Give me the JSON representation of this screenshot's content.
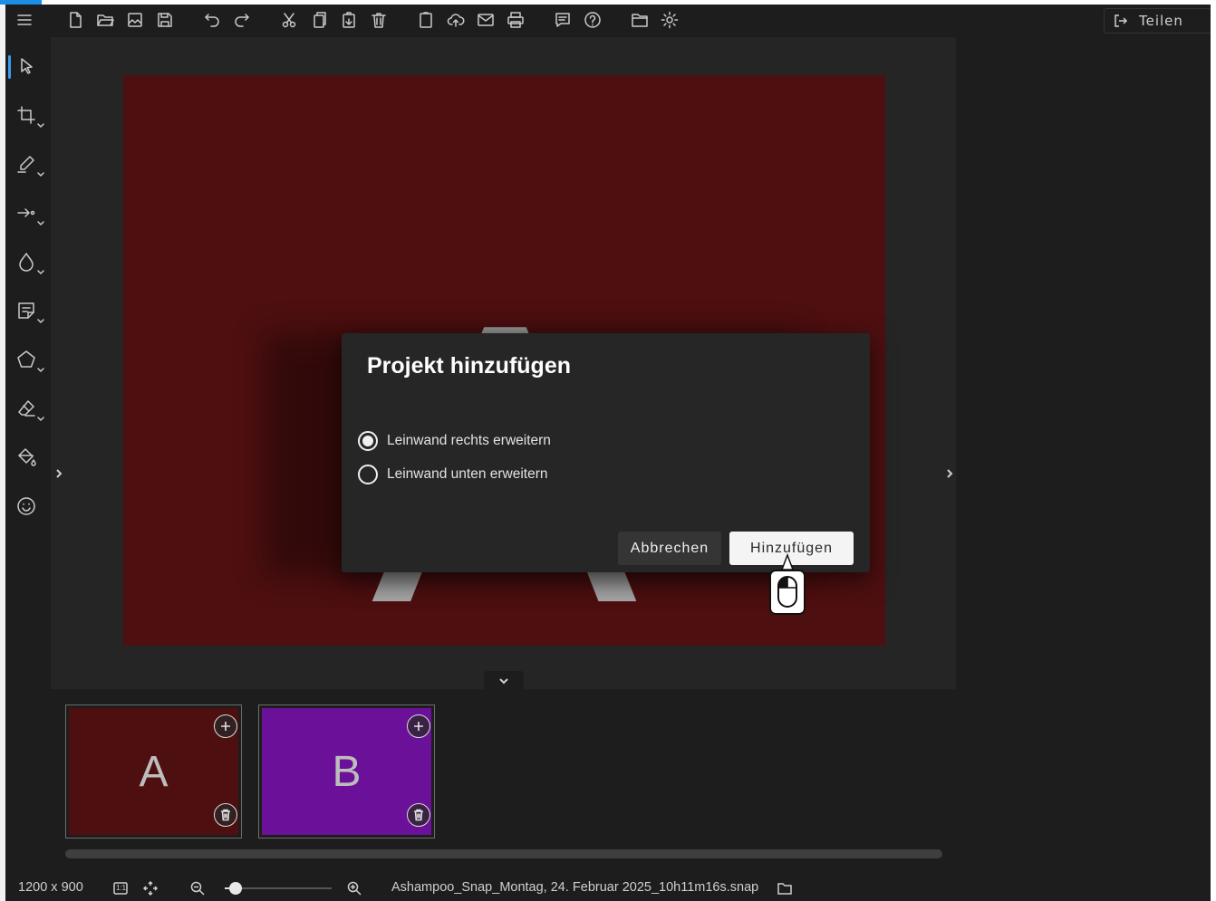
{
  "toolbar": {
    "share_label": "Teilen"
  },
  "canvas": {
    "letter": "A",
    "background_color": "#4e0f10"
  },
  "dialog": {
    "title": "Projekt hinzufügen",
    "options": [
      {
        "label": "Leinwand rechts erweitern",
        "selected": true
      },
      {
        "label": "Leinwand unten erweitern",
        "selected": false
      }
    ],
    "cancel_label": "Abbrechen",
    "add_label": "Hinzufügen"
  },
  "thumbnails": [
    {
      "label": "A",
      "color": "#4e0f10"
    },
    {
      "label": "B",
      "color": "#6b1199"
    }
  ],
  "statusbar": {
    "dimensions": "1200 x 900",
    "actual_size_label": "1:1",
    "zoom_level": 0.1,
    "filename": "Ashampoo_Snap_Montag, 24. Februar 2025_10h11m16s.snap"
  },
  "colors": {
    "accent": "#3b9cf0",
    "corner": "#1b8fe6"
  }
}
